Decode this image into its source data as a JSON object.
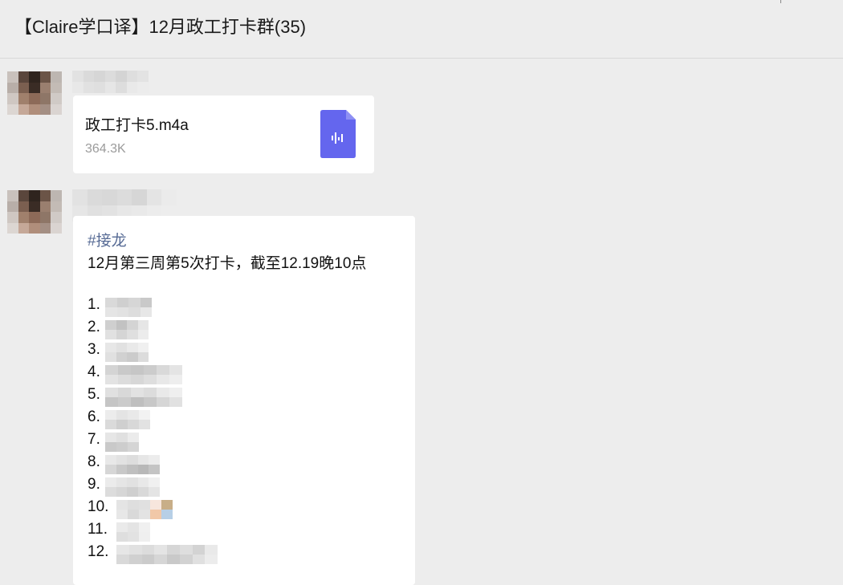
{
  "header": {
    "title": "【Claire学口译】12月政工打卡群(35)"
  },
  "messages": [
    {
      "type": "file",
      "file": {
        "name": "政工打卡5.m4a",
        "size": "364.3K",
        "icon": "audio-file-icon",
        "icon_color": "#6466ee"
      }
    },
    {
      "type": "text",
      "tag": "#接龙",
      "line1": "12月第三周第5次打卡，截至12.19晚10点",
      "list": [
        "1.",
        "2.",
        "3.",
        "4.",
        "5.",
        "6.",
        "7.",
        "8.",
        "9.",
        "10.",
        "11.",
        "12."
      ]
    }
  ],
  "colors": {
    "background": "#ededed",
    "bubble": "#ffffff",
    "link": "#576b95",
    "file_size": "#9b9b9b"
  }
}
